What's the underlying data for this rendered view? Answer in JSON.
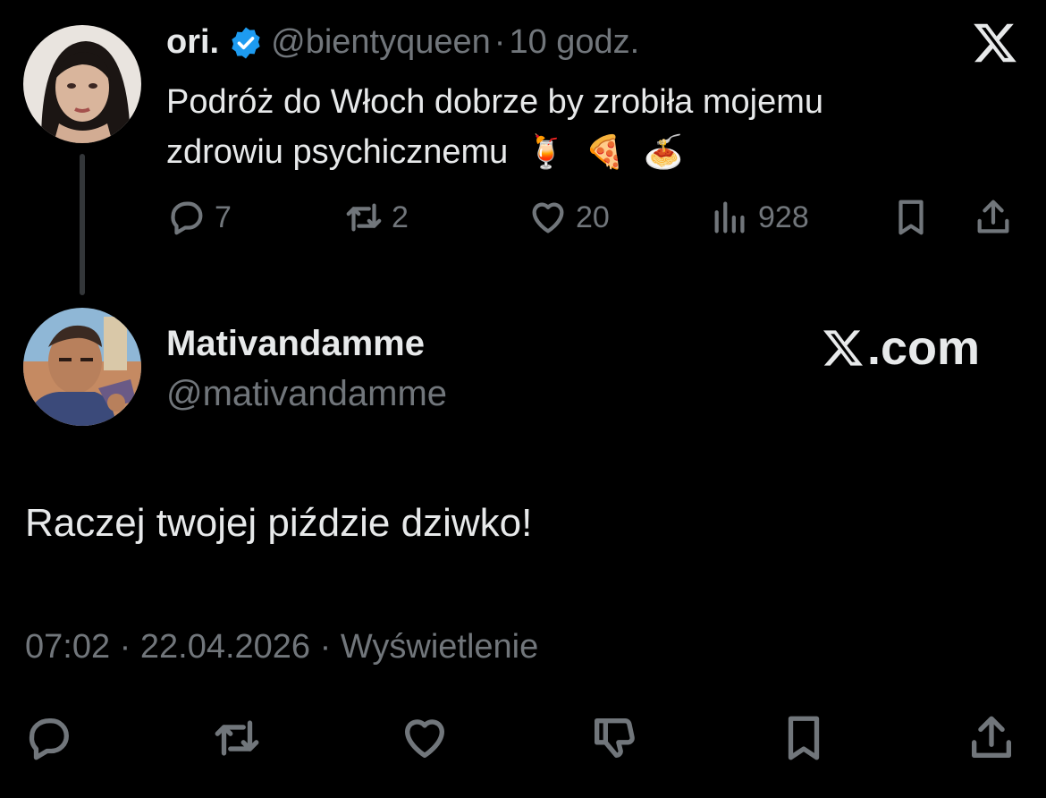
{
  "original_tweet": {
    "display_name": "ori.",
    "handle": "@bientyqueen",
    "separator": "·",
    "time": "10 godz.",
    "text_line1": "Podróż do Włoch dobrze by zrobiła mojemu",
    "text_line2": "zdrowiu psychicznemu",
    "emojis": [
      "🍹",
      "🍕",
      "🍝"
    ],
    "avatar_icon": "avatar-woman-photo",
    "verified_icon": "verified-badge-icon",
    "platform_icon": "x-logo-icon",
    "stats": {
      "replies": "7",
      "reposts": "2",
      "likes": "20",
      "views": "928"
    }
  },
  "reply_tweet": {
    "display_name": "Mativandamme",
    "handle": "@mativandamme",
    "watermark": ".com",
    "text": "Raczej twojej piździe dziwko!",
    "time": "07:02",
    "separator1": "·",
    "date": "22.04.2026",
    "separator2": "·",
    "views_label": "Wyświetlenie"
  },
  "colors": {
    "background": "#000000",
    "primary_text": "#e7e9ea",
    "secondary_text": "#71767b",
    "verified_blue": "#1d9bf0",
    "thread_line": "#333639"
  }
}
